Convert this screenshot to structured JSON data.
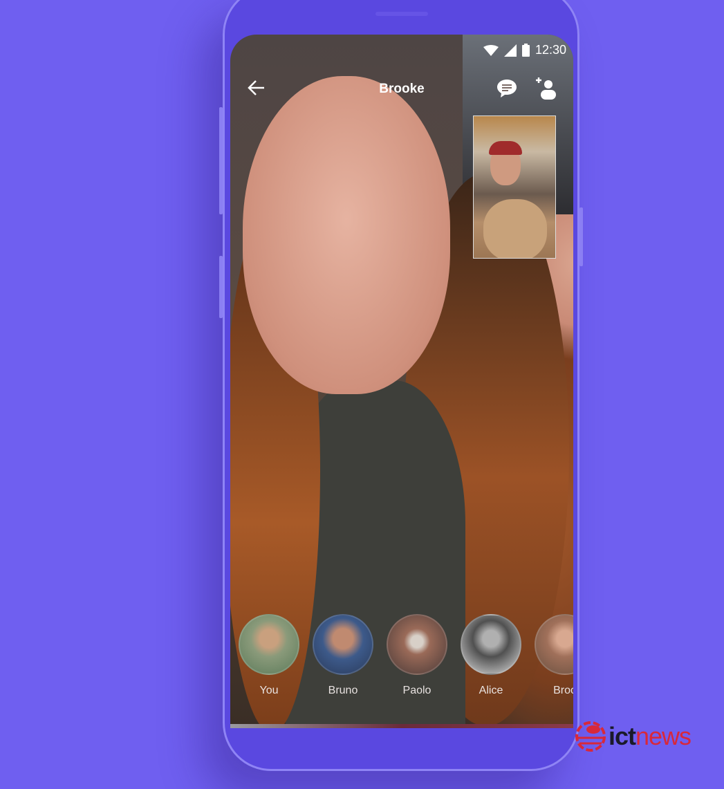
{
  "status_bar": {
    "time": "12:30",
    "icons": [
      "wifi-icon",
      "signal-icon",
      "battery-icon"
    ]
  },
  "header": {
    "title": "Brooke",
    "back_icon": "arrow-left-icon",
    "actions": [
      "chat-icon",
      "add-person-icon"
    ]
  },
  "participants": [
    {
      "name": "You",
      "color": "#8a9a7a"
    },
    {
      "name": "Bruno",
      "color": "#3d5a8a"
    },
    {
      "name": "Paolo",
      "color": "#6a4a48"
    },
    {
      "name": "Alice",
      "color": "#707070"
    },
    {
      "name": "Broo",
      "color": "#a0705a"
    }
  ],
  "watermark": {
    "part1": "ict",
    "part2": "news"
  },
  "colors": {
    "background": "#6f5ff0",
    "phone": "#5a48e0",
    "logo_red": "#d8283a"
  }
}
